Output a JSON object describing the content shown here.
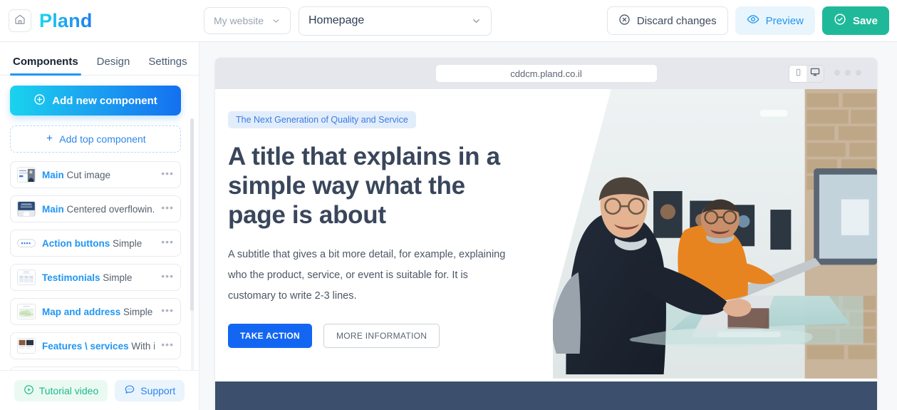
{
  "app": {
    "logo_text": "Pland",
    "home_icon": "home-icon"
  },
  "topbar": {
    "site_selector": {
      "label": "My website",
      "icon": "chevron-down-icon"
    },
    "page_selector": {
      "label": "Homepage",
      "icon": "chevron-down-icon"
    },
    "discard_button": {
      "label": "Discard changes",
      "icon": "close-circle-icon"
    },
    "preview_button": {
      "label": "Preview",
      "icon": "eye-icon"
    },
    "save_button": {
      "label": "Save",
      "icon": "check-circle-icon"
    }
  },
  "sidebar": {
    "tabs": [
      {
        "label": "Components",
        "active": true
      },
      {
        "label": "Design",
        "active": false
      },
      {
        "label": "Settings",
        "active": false
      }
    ],
    "add_new_component": {
      "label": "Add new component",
      "icon": "plus-circle-icon"
    },
    "add_top_component": {
      "label": "Add top component",
      "icon": "plus-icon"
    },
    "components": [
      {
        "name": "Main",
        "variant": "Cut image",
        "thumb": "main-cut-image-thumb",
        "menu": "more-options-icon"
      },
      {
        "name": "Main",
        "variant": "Centered overflowin...",
        "thumb": "main-centered-thumb",
        "menu": "more-options-icon"
      },
      {
        "name": "Action buttons",
        "variant": "Simple",
        "thumb": "action-buttons-thumb",
        "menu": "more-options-icon"
      },
      {
        "name": "Testimonials",
        "variant": "Simple",
        "thumb": "testimonials-thumb",
        "menu": "more-options-icon"
      },
      {
        "name": "Map and address",
        "variant": "Simple",
        "thumb": "map-address-thumb",
        "menu": "more-options-icon"
      },
      {
        "name": "Features \\ services",
        "variant": "With i...",
        "thumb": "features-services-thumb",
        "menu": "more-options-icon"
      },
      {
        "name": "",
        "variant": "",
        "thumb": "partial-thumb",
        "menu": "more-options-icon"
      }
    ],
    "footer": {
      "tutorial": {
        "label": "Tutorial video",
        "icon": "play-circle-icon"
      },
      "support": {
        "label": "Support",
        "icon": "chat-bubble-icon"
      }
    }
  },
  "preview": {
    "url": "cddcm.pland.co.il",
    "device_mobile_icon": "mobile-icon",
    "device_desktop_icon": "desktop-icon",
    "device_selected": "desktop",
    "window_dots": "window-dots"
  },
  "page": {
    "badge": "The Next Generation of Quality and Service",
    "heading": "A title that explains in a simple way what the page is about",
    "subtitle": "A subtitle that gives a bit more detail, for example, explaining who the product, service, or event is suitable for. It is customary to write 2-3 lines.",
    "primary_cta": "TAKE ACTION",
    "secondary_cta": "MORE INFORMATION",
    "hero_image_alt": "two-men-at-counter-with-laptop"
  },
  "colors": {
    "brand_cyan": "#1ad3ee",
    "brand_blue": "#1470f0",
    "accent_blue": "#2196f3",
    "save_green": "#1fb99a",
    "cta_blue": "#1266f1",
    "footer_navy": "#3c506d",
    "heading_navy": "#39465b"
  }
}
